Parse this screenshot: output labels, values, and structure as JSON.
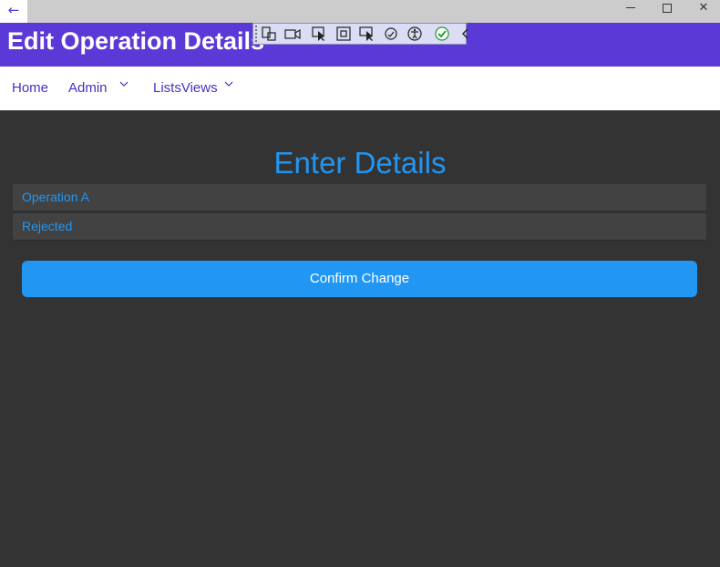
{
  "window": {
    "back_glyph": "←",
    "close_glyph": "✕"
  },
  "header": {
    "title": "Edit Operation Details"
  },
  "debug_toolbar": {
    "icons": [
      "visual-tree-icon",
      "record-icon",
      "select-element-icon",
      "layout-adorner-icon",
      "track-focus-icon",
      "binding-failures-icon",
      "accessibility-icon",
      "check-icon",
      "collapse-chevron-icon"
    ]
  },
  "nav": {
    "home": "Home",
    "admin": "Admin",
    "lists_views": "ListsViews"
  },
  "main": {
    "section_title": "Enter Details",
    "operation_value": "Operation A",
    "status_value": "Rejected",
    "confirm_label": "Confirm Change"
  },
  "colors": {
    "header_bg": "#5b39d6",
    "page_bg": "#333333",
    "accent": "#2196f3",
    "field_bg": "#424242"
  }
}
